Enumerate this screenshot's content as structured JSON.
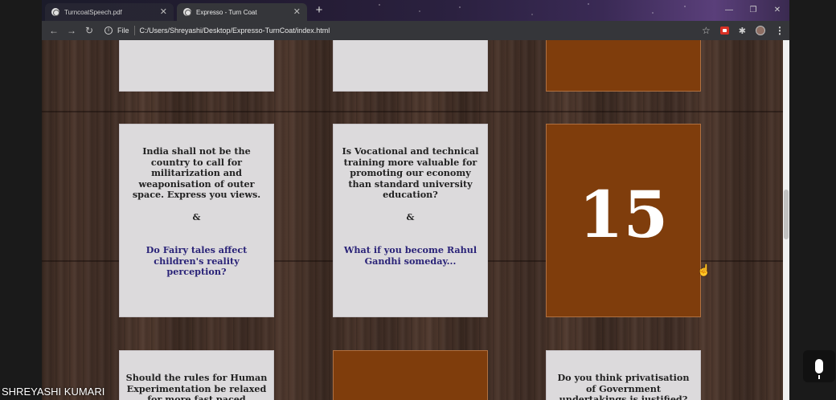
{
  "browser": {
    "tabs": [
      {
        "title": "TurncoatSpeech.pdf",
        "active": false
      },
      {
        "title": "Expresso - Turn Coat",
        "active": true
      }
    ],
    "new_tab": "+",
    "window_controls": {
      "minimize": "—",
      "maximize": "❐",
      "close": "✕"
    },
    "toolbar": {
      "back": "←",
      "forward": "→",
      "reload": "↻",
      "info": "i",
      "file_label": "File",
      "url": "C:/Users/Shreyashi/Desktop/Expresso-TurnCoat/index.html",
      "bookmark": "☆",
      "extensions": "✱",
      "menu": "⋮"
    }
  },
  "cards": [
    {
      "id": "top-left",
      "color": "light"
    },
    {
      "id": "top-middle",
      "color": "light"
    },
    {
      "id": "top-right",
      "color": "brown"
    },
    {
      "id": "mid-left",
      "color": "light",
      "question": "India shall not be the country to call for militarization and weaponisation of outer space. Express you views.",
      "separator": "&",
      "question2": "Do Fairy tales affect children's reality perception?"
    },
    {
      "id": "mid-middle",
      "color": "light",
      "question": "Is Vocational and technical training more valuable for promoting our economy than standard university education?",
      "separator": "&",
      "question2": "What if you become Rahul Gandhi someday..."
    },
    {
      "id": "mid-right",
      "color": "brown",
      "number": "15"
    },
    {
      "id": "bottom-left",
      "color": "light",
      "question": "Should the rules for Human Experimentation be relaxed for more fast paced research?"
    },
    {
      "id": "bottom-middle",
      "color": "brown"
    },
    {
      "id": "bottom-right",
      "color": "light",
      "question": "Do you think privatisation of Government undertakings is justified?"
    }
  ],
  "colors": {
    "card_light": "#dcdadc",
    "card_brown": "#7f3d0c",
    "question2": "#2a2378"
  },
  "call": {
    "participant_name": "SHREYASHI KUMARI",
    "mic_icon": "microphone-icon"
  }
}
